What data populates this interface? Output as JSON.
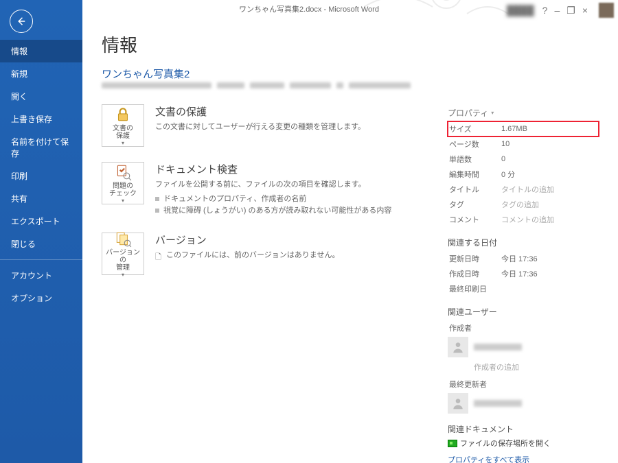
{
  "titlebar": {
    "title": "ワンちゃん写真集2.docx - Microsoft Word",
    "help": "?",
    "min": "–",
    "restore": "❐",
    "close": "×"
  },
  "sidebar": {
    "items": [
      {
        "label": "情報",
        "active": true
      },
      {
        "label": "新規"
      },
      {
        "label": "開く"
      },
      {
        "label": "上書き保存"
      },
      {
        "label": "名前を付けて保存"
      },
      {
        "label": "印刷"
      },
      {
        "label": "共有"
      },
      {
        "label": "エクスポート"
      },
      {
        "label": "閉じる"
      }
    ],
    "footer": [
      {
        "label": "アカウント"
      },
      {
        "label": "オプション"
      }
    ]
  },
  "page": {
    "heading": "情報",
    "filename": "ワンちゃん写真集2"
  },
  "sections": {
    "protect": {
      "btn": "文書の\n保護",
      "title": "文書の保護",
      "desc": "この文書に対してユーザーが行える変更の種類を管理します。"
    },
    "inspect": {
      "btn": "問題の\nチェック",
      "title": "ドキュメント検査",
      "desc": "ファイルを公開する前に、ファイルの次の項目を確認します。",
      "b1": "ドキュメントのプロパティ、作成者の名前",
      "b2": "視覚に障碍 (しょうがい) のある方が読み取れない可能性がある内容"
    },
    "versions": {
      "btn": "バージョンの\n管理",
      "title": "バージョン",
      "b1": "このファイルには、前のバージョンはありません。"
    }
  },
  "props": {
    "header": "プロパティ",
    "rows": [
      {
        "k": "サイズ",
        "v": "1.67MB",
        "hl": true
      },
      {
        "k": "ページ数",
        "v": "10"
      },
      {
        "k": "単語数",
        "v": "0"
      },
      {
        "k": "編集時間",
        "v": "0 分"
      },
      {
        "k": "タイトル",
        "v": "タイトルの追加",
        "ph": true
      },
      {
        "k": "タグ",
        "v": "タグの追加",
        "ph": true
      },
      {
        "k": "コメント",
        "v": "コメントの追加",
        "ph": true
      }
    ],
    "dates": {
      "header": "関連する日付",
      "rows": [
        {
          "k": "更新日時",
          "v": "今日 17:36"
        },
        {
          "k": "作成日時",
          "v": "今日 17:36"
        },
        {
          "k": "最終印刷日",
          "v": ""
        }
      ]
    },
    "users": {
      "header": "関連ユーザー",
      "author_k": "作成者",
      "add_author": "作成者の追加",
      "lastmod_k": "最終更新者"
    },
    "reldocs": {
      "header": "関連ドキュメント",
      "open": "ファイルの保存場所を開く"
    },
    "showall": "プロパティをすべて表示"
  }
}
